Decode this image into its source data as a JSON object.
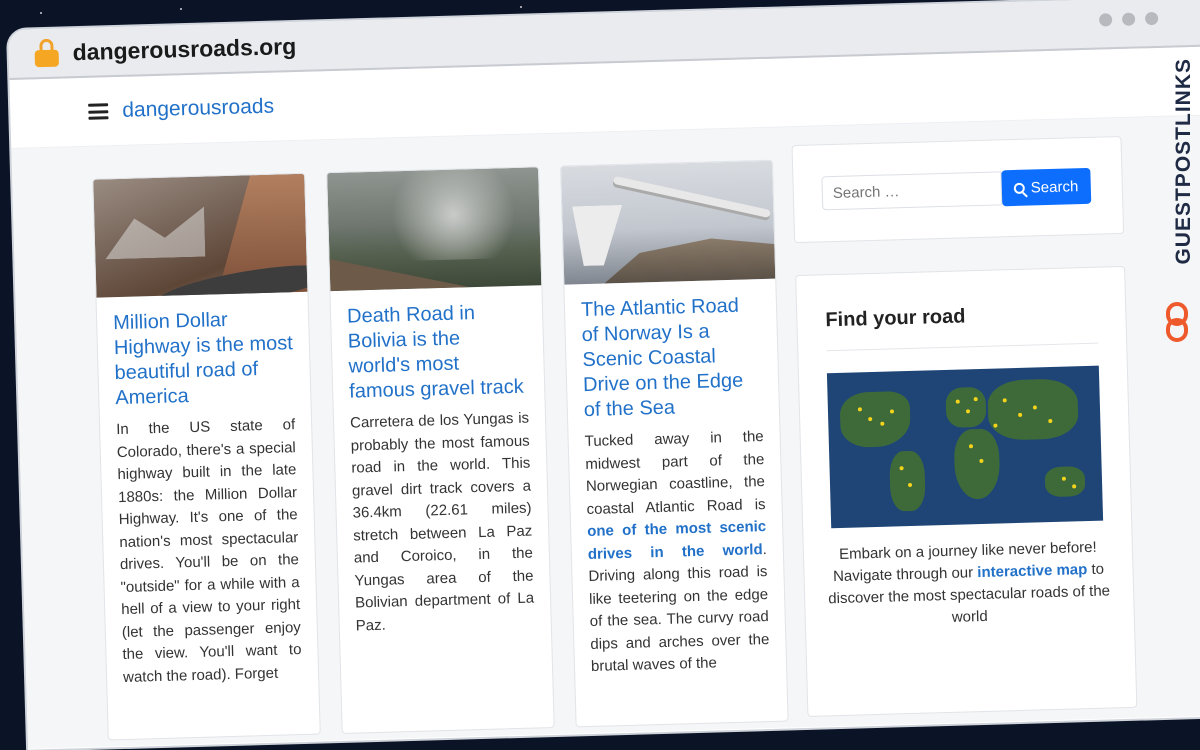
{
  "browser": {
    "url": "dangerousroads.org"
  },
  "site": {
    "brand": "dangerousroads"
  },
  "articles": [
    {
      "title": "Million Dollar Highway is the most beautiful road of America",
      "excerpt": "In the US state of Colorado, there's a special highway built in the late 1880s: the Million Dollar Highway. It's one of the nation's most spectacular drives. You'll be on the \"outside\" for a while with a hell of a view to your right (let the passenger enjoy the view. You'll want to watch the road). Forget"
    },
    {
      "title": "Death Road in Bolivia is the world's most famous gravel track",
      "excerpt": "Carretera de los Yungas is probably the most famous road in the world. This gravel dirt track covers a 36.4km (22.61 miles) stretch between La Paz and Coroico, in the Yungas area of the Bolivian department of La Paz."
    },
    {
      "title": "The Atlantic Road of Norway Is a Scenic Coastal Drive on the Edge of the Sea",
      "excerpt_before": "Tucked away in the midwest part of the Norwegian coastline, the coastal Atlantic Road is ",
      "excerpt_link": "one of the most scenic drives in the world",
      "excerpt_after": ". Driving along this road is like teetering on the edge of the sea. The curvy road dips and arches over the brutal waves of the"
    }
  ],
  "sidebar": {
    "search_placeholder": "Search …",
    "search_button": "Search",
    "find_title": "Find your road",
    "find_desc_before": "Embark on a journey like never before! Navigate through our ",
    "find_desc_link": "interactive map",
    "find_desc_after": " to discover the most spectacular roads of the world"
  },
  "watermark": {
    "label": "GUESTPOSTLINKS"
  },
  "colors": {
    "link": "#2271c9",
    "button": "#0d6efd",
    "watermark_icon": "#ee5a2b"
  }
}
